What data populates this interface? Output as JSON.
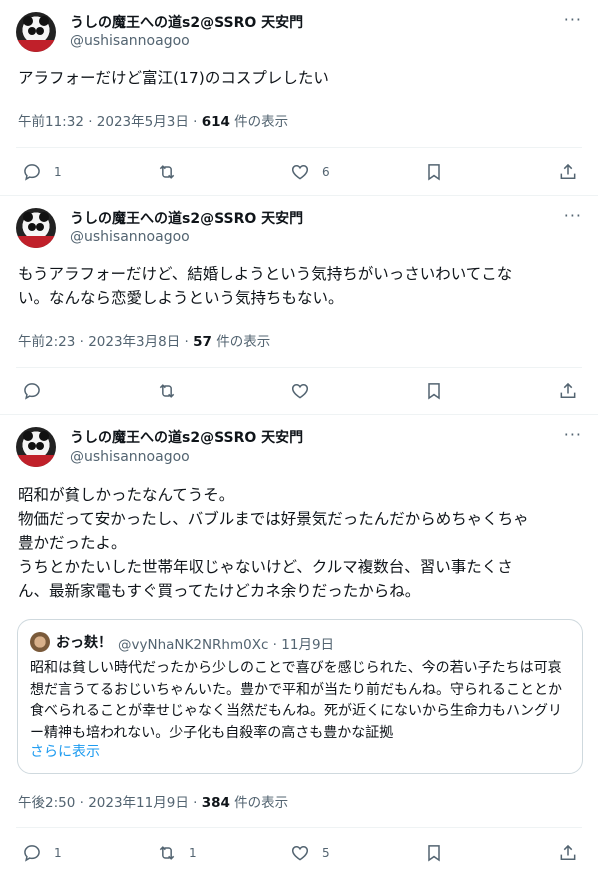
{
  "tweets": [
    {
      "author_name": "うしの魔王への道s2@SSRO 天安門",
      "handle": "@ushisannoagoo",
      "more": "···",
      "text": "アラフォーだけど富江(17)のコスプレしたい",
      "time": "午前11:32 · 2023年5月3日 · ",
      "views_count": "614",
      "views_label": " 件の表示",
      "reply_count": "1",
      "retweet_count": "",
      "like_count": "6"
    },
    {
      "author_name": "うしの魔王への道s2@SSRO 天安門",
      "handle": "@ushisannoagoo",
      "more": "···",
      "text": "もうアラフォーだけど、結婚しようという気持ちがいっさいわいてこな\nい。なんなら恋愛しようという気持ちもない。",
      "time": "午前2:23 · 2023年3月8日 · ",
      "views_count": "57",
      "views_label": " 件の表示",
      "reply_count": "",
      "retweet_count": "",
      "like_count": ""
    },
    {
      "author_name": "うしの魔王への道s2@SSRO 天安門",
      "handle": "@ushisannoagoo",
      "more": "···",
      "text": "昭和が貧しかったなんてうそ。\n物価だって安かったし、バブルまでは好景気だったんだからめちゃくちゃ\n豊かだったよ。\nうちとかたいした世帯年収じゃないけど、クルマ複数台、習い事たくさ\nん、最新家電もすぐ買ってたけどカネ余りだったからね。",
      "time": "午後2:50 · 2023年11月9日 · ",
      "views_count": "384",
      "views_label": " 件の表示",
      "reply_count": "1",
      "retweet_count": "1",
      "like_count": "5",
      "quote": {
        "author_name": "おっ麸！",
        "handle_time": "@vyNhaNK2NRhm0Xc · 11月9日",
        "text": "昭和は貧しい時代だったから少しのことで喜びを感じられた、今の若い子たちは可哀想だ言うてるおじいちゃんいた。豊かで平和が当たり前だもんね。守られることとか食べられることが幸せじゃなく当然だもんね。死が近くにないから生命力もハングリー精神も培われない。少子化も自殺率の高さも豊かな証拠",
        "show_more": "さらに表示"
      }
    }
  ],
  "icons": {
    "reply": "reply-icon",
    "retweet": "retweet-icon",
    "like": "heart-icon",
    "bookmark": "bookmark-icon",
    "share": "share-icon"
  }
}
